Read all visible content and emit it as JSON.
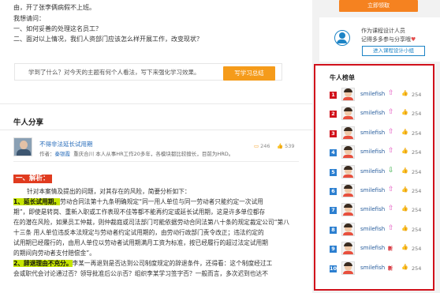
{
  "question": {
    "lines": [
      "由，开了张李俩病假不上班。",
      "我想请问：",
      "一、如何妥善的处理这名员工？",
      "二、面对以上情况，我们人资部门应该怎么样开展工作，改变现状？"
    ]
  },
  "learn_box": {
    "prompt": "学到了什么？对今天的主题有何个人看法，写下来强化学习效果。",
    "button": "写学习总结"
  },
  "section_title": "牛人分享",
  "post": {
    "title": "不得非法延长试用期",
    "author_label": "作者：",
    "author": "秦银霞",
    "author_desc": "重庆合川 本人从事HR工作20多年，各模块都比较擅长，目前为HRD。",
    "comments": "246",
    "likes": "539"
  },
  "article": {
    "heading": "一、解析：",
    "intro": "针对本案情及提出的问题，对其存在的风险，简要分析如下：",
    "p1_hl": "1、延长试用期。",
    "p1_l1": "劳动合同法第十九条明确规定“同一用人单位与同一劳动者只能约定一次试用",
    "p1_l2": "期”，即使是转岗、重新入职或工作表现不佳等都不能再约定或延长试用期，这是许多单位都存",
    "p1_l3": "在的潜在风险，如果员工仲裁，则仲裁庭或司法部门可能依据劳动合同法第八十条的规定裁定公司“第八",
    "p1_l4": "十三条   用人单位违反本法规定与劳动者约定试用期的，由劳动行政部门责令改正；违法约定的",
    "p1_l5": "试用期已经履行的，由用人单位以劳动者试用期满月工资为标准，按已经履行的超过法定试用期",
    "p1_l6": "的期间向劳动者支付赔偿金”。",
    "p2_hl": "2、辞退理由不充分。",
    "p2_l1": "李某一再退到是否达到公司制度规定的辞退条件，还得看：这个制度经过工",
    "p2_l2": "会或职代会讨论通过否？领导批准后公示否？组织李某学习签字否？一般而言，多次迟到也达不"
  },
  "sidebar": {
    "share_button": "立即领取",
    "help_line1": "作为课程设计人员",
    "help_line2": "记得多多参与分享哦",
    "help_heart": "♥",
    "group_button": "进入课程设计小组",
    "rank_title": "牛人榜单",
    "rank": [
      {
        "num": "1",
        "name": "smilefish",
        "trend": "up",
        "count": "254"
      },
      {
        "num": "2",
        "name": "smilefish",
        "trend": "up",
        "count": "254"
      },
      {
        "num": "3",
        "name": "smilefish",
        "trend": "up",
        "count": "254"
      },
      {
        "num": "4",
        "name": "smilefish",
        "trend": "up",
        "count": "254"
      },
      {
        "num": "5",
        "name": "smilefish",
        "trend": "down",
        "count": "254"
      },
      {
        "num": "6",
        "name": "smilefish",
        "trend": "up",
        "count": "254"
      },
      {
        "num": "7",
        "name": "smilefish",
        "trend": "up",
        "count": "254"
      },
      {
        "num": "8",
        "name": "smilefish",
        "trend": "up",
        "count": "254"
      },
      {
        "num": "9",
        "name": "smilefish",
        "trend": "new",
        "count": "254"
      },
      {
        "num": "10",
        "name": "smilefish",
        "trend": "new",
        "count": "254"
      }
    ],
    "trend_symbols": {
      "up": "⇧",
      "down": "⇩",
      "new": "新"
    }
  },
  "colors": {
    "accent": "#f59b1a",
    "highlight": "#c5e400",
    "rank_border": "#d1111b",
    "link": "#2a6ebb"
  }
}
